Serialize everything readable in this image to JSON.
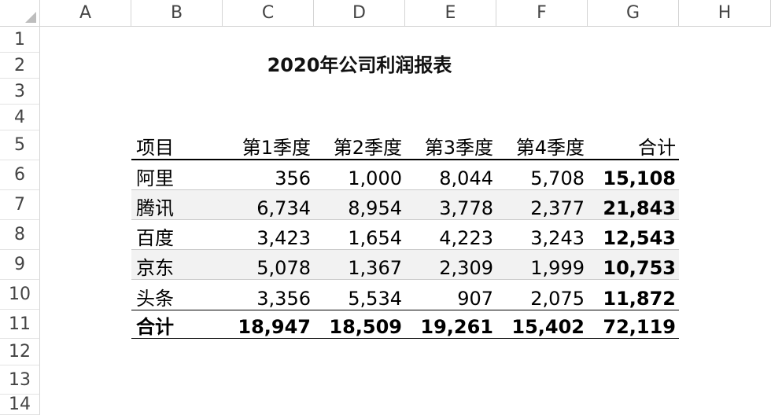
{
  "columns": [
    "A",
    "B",
    "C",
    "D",
    "E",
    "F",
    "G",
    "H"
  ],
  "rows": [
    "1",
    "2",
    "3",
    "4",
    "5",
    "6",
    "7",
    "8",
    "9",
    "10",
    "11",
    "12",
    "13",
    "14"
  ],
  "title": "2020年公司利润报表",
  "table": {
    "header": [
      "项目",
      "第1季度",
      "第2季度",
      "第3季度",
      "第4季度",
      "合计"
    ],
    "body": [
      [
        "阿里",
        "356",
        "1,000",
        "8,044",
        "5,708",
        "15,108"
      ],
      [
        "腾讯",
        "6,734",
        "8,954",
        "3,778",
        "2,377",
        "21,843"
      ],
      [
        "百度",
        "3,423",
        "1,654",
        "4,223",
        "3,243",
        "12,543"
      ],
      [
        "京东",
        "5,078",
        "1,367",
        "2,309",
        "1,999",
        "10,753"
      ],
      [
        "头条",
        "3,356",
        "5,534",
        "907",
        "2,075",
        "11,872"
      ]
    ],
    "total": [
      "合计",
      "18,947",
      "18,509",
      "19,261",
      "15,402",
      "72,119"
    ]
  },
  "colors": {
    "band": "#f2f2f2",
    "gridline": "#d4d4d4",
    "header_text": "#444444"
  }
}
